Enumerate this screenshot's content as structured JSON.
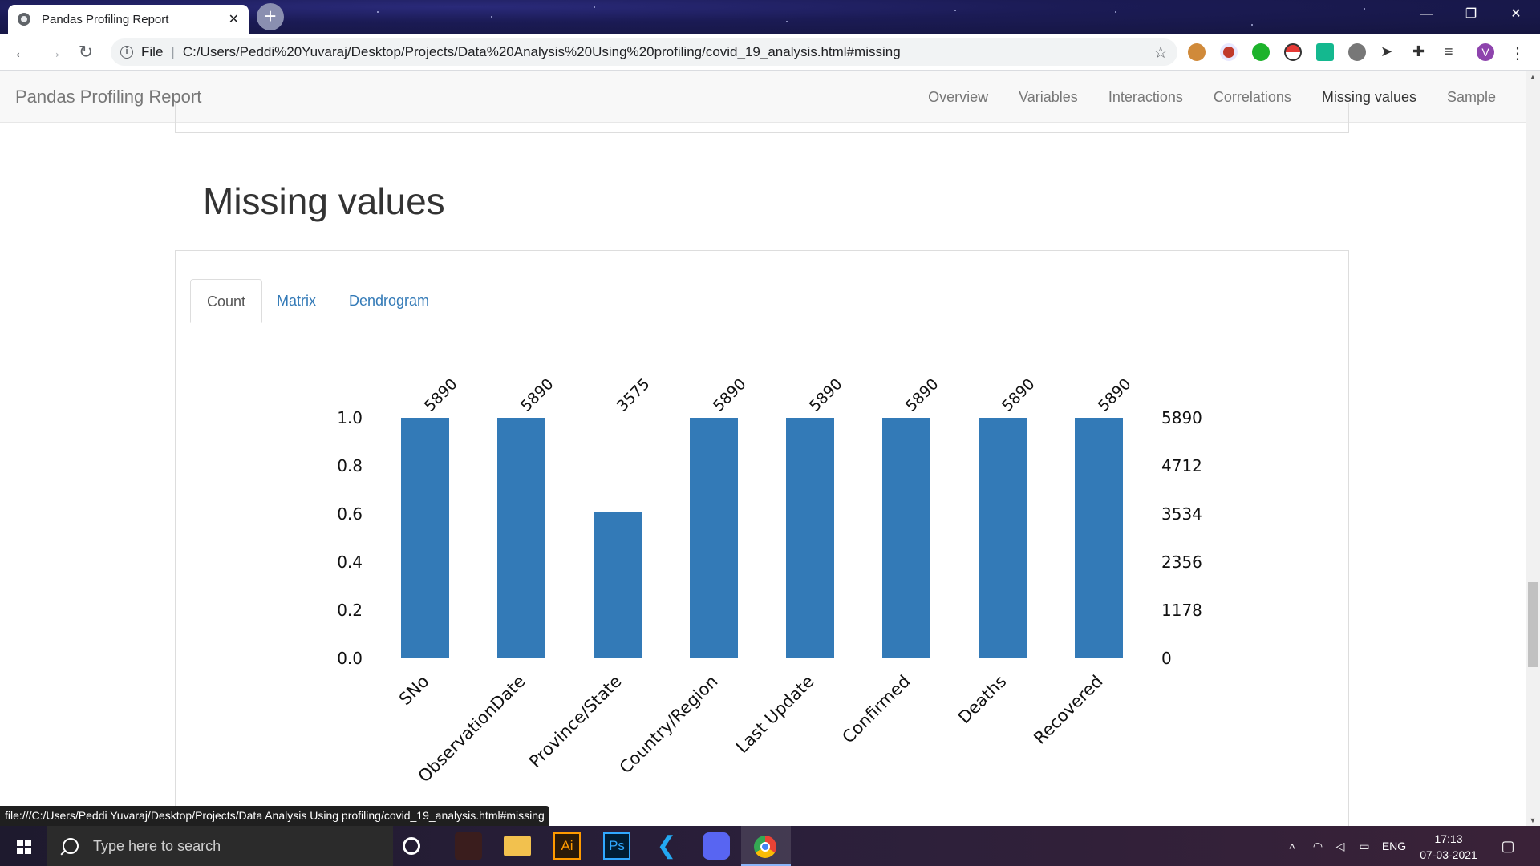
{
  "browser": {
    "tab_title": "Pandas Profiling Report",
    "tab_close": "✕",
    "new_tab": "+",
    "url_scheme_label": "File",
    "url": "C:/Users/Peddi%20Yuvaraj/Desktop/Projects/Data%20Analysis%20Using%20profiling/covid_19_analysis.html#missing",
    "minimize": "—",
    "restore": "❐",
    "close": "✕",
    "back": "←",
    "forward": "→",
    "reload": "↻",
    "bookmark_star": "☆",
    "profile_initial": "V"
  },
  "navbar": {
    "brand": "Pandas Profiling Report",
    "links": [
      "Overview",
      "Variables",
      "Interactions",
      "Correlations",
      "Missing values",
      "Sample"
    ],
    "active": "Missing values"
  },
  "section": {
    "title": "Missing values",
    "tabs": [
      "Count",
      "Matrix",
      "Dendrogram"
    ],
    "active_tab": "Count"
  },
  "chart_data": {
    "type": "bar",
    "categories": [
      "SNo",
      "ObservationDate",
      "Province/State",
      "Country/Region",
      "Last Update",
      "Confirmed",
      "Deaths",
      "Recovered"
    ],
    "values": [
      5890,
      5890,
      3575,
      5890,
      5890,
      5890,
      5890,
      5890
    ],
    "fractions": [
      1.0,
      1.0,
      0.607,
      1.0,
      1.0,
      1.0,
      1.0,
      1.0
    ],
    "bar_labels": [
      "5890",
      "5890",
      "3575",
      "5890",
      "5890",
      "5890",
      "5890",
      "5890"
    ],
    "left_ticks": [
      "0.0",
      "0.2",
      "0.4",
      "0.6",
      "0.8",
      "1.0"
    ],
    "right_ticks": [
      "0",
      "1178",
      "2356",
      "3534",
      "4712",
      "5890"
    ],
    "ylim": [
      0,
      1
    ],
    "bar_color": "#337ab7",
    "grid": false
  },
  "status_bar": {
    "link_preview": "file:///C:/Users/Peddi Yuvaraj/Desktop/Projects/Data Analysis Using profiling/covid_19_analysis.html#missing"
  },
  "taskbar": {
    "search_placeholder": "Type here to search",
    "language": "ENG",
    "time": "17:13",
    "date": "07-03-2021"
  },
  "colors": {
    "link": "#337ab7",
    "title_bg": "#1b1b55"
  }
}
